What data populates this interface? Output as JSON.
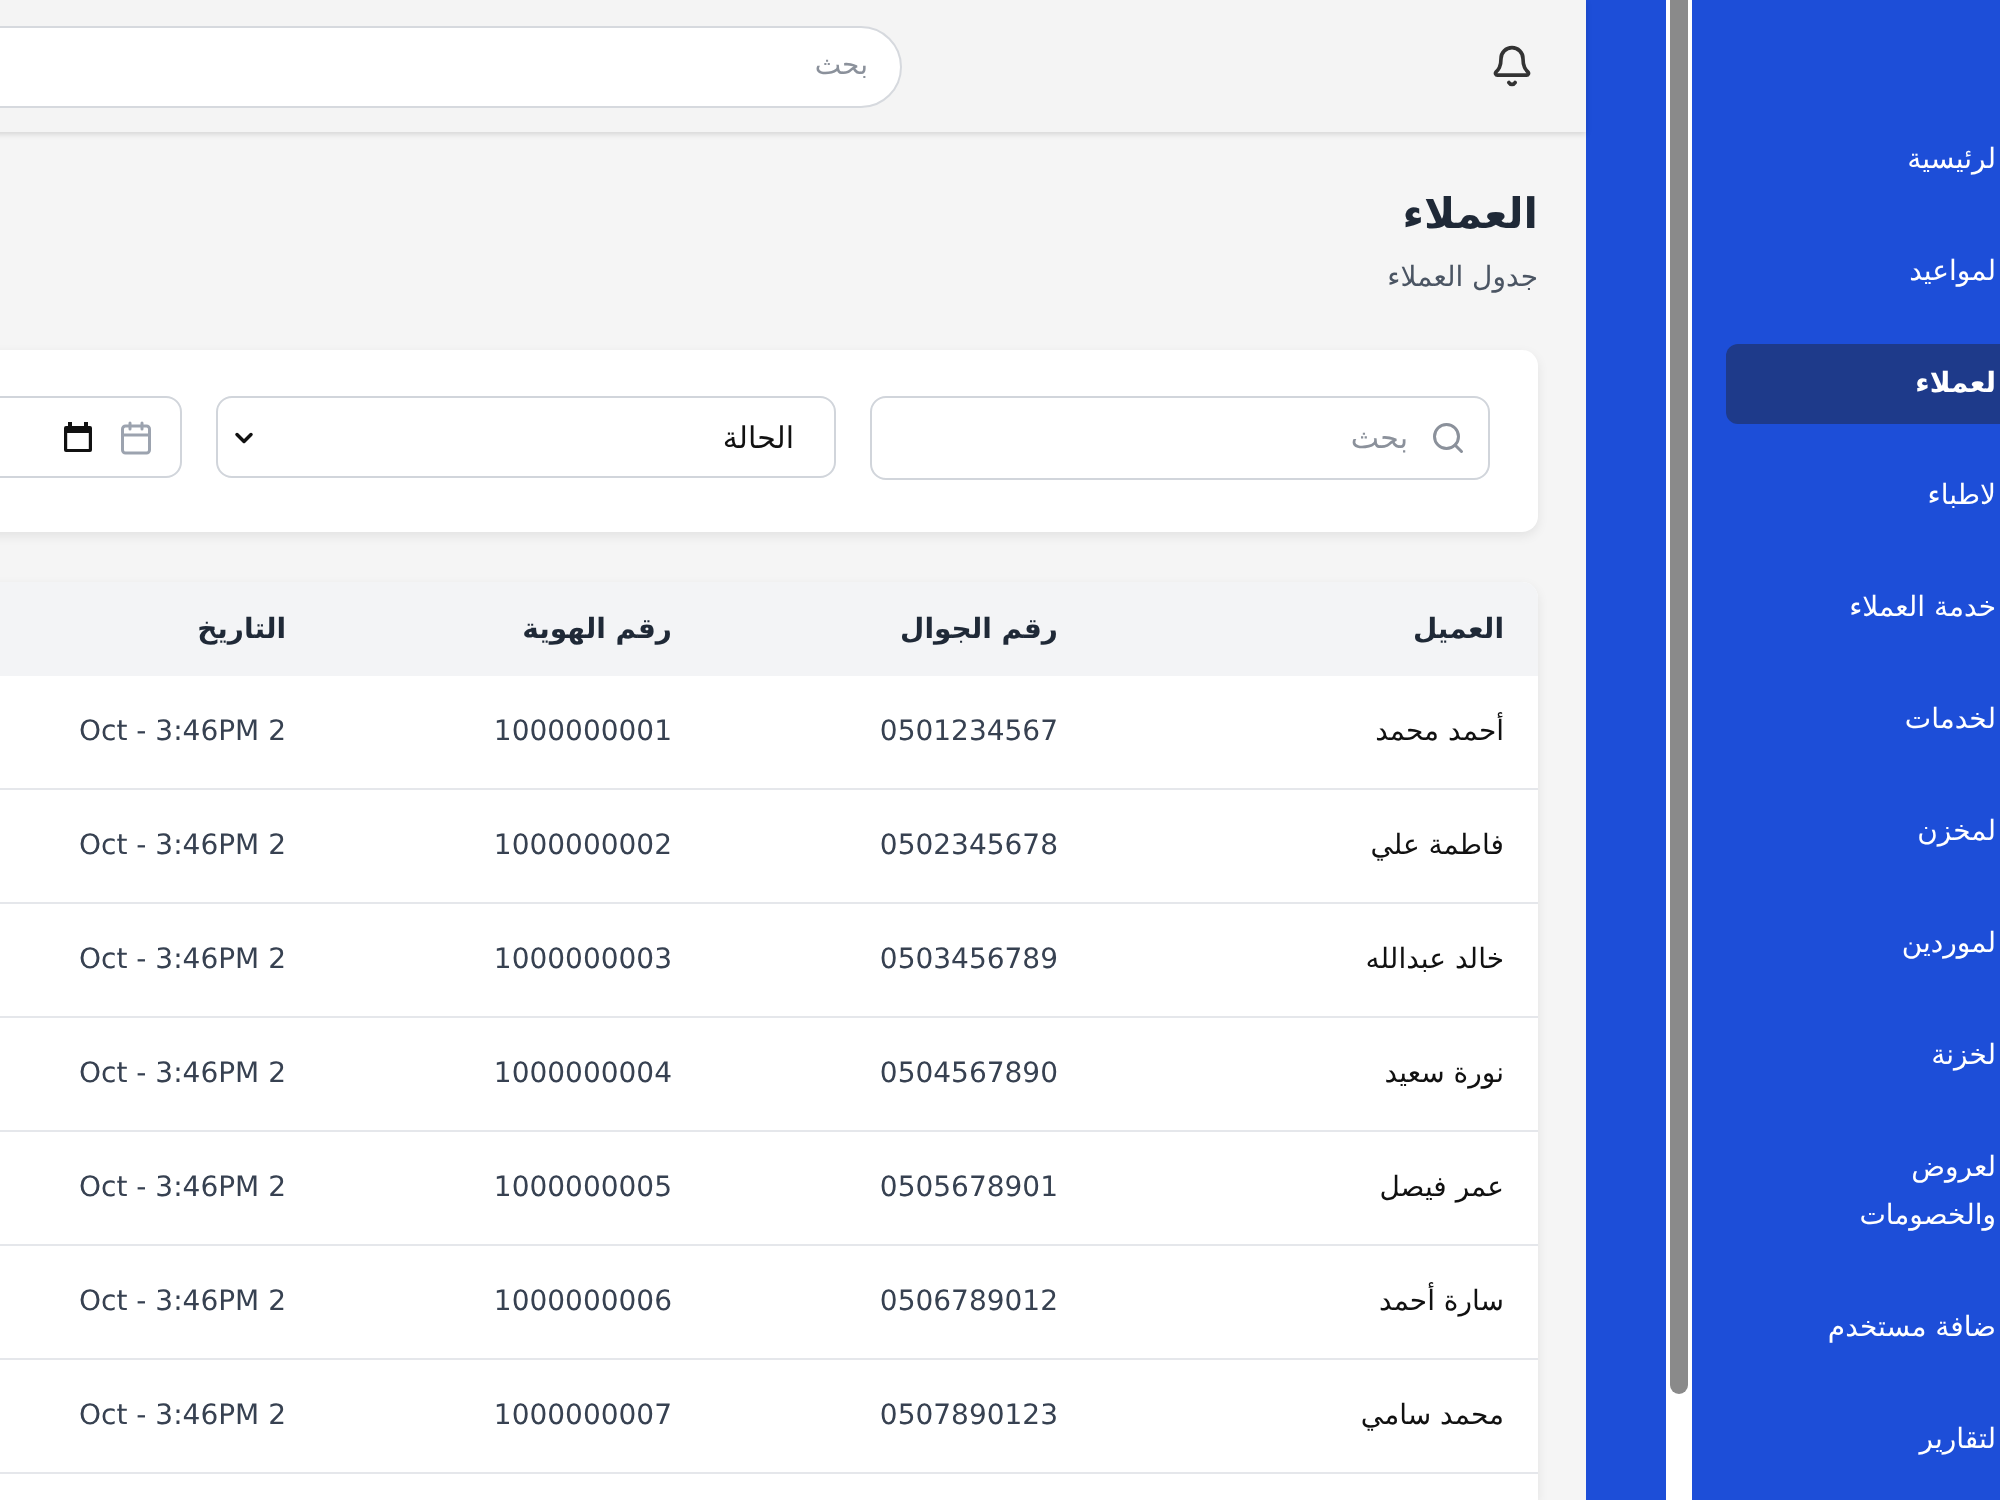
{
  "sidebar": {
    "items": [
      {
        "label": "لرئيسية",
        "selected": false
      },
      {
        "label": "لمواعيد",
        "selected": false
      },
      {
        "label": "لعملاء",
        "selected": true
      },
      {
        "label": "لاطباء",
        "selected": false
      },
      {
        "label": "خدمة العملاء",
        "selected": false
      },
      {
        "label": "لخدمات",
        "selected": false
      },
      {
        "label": "لمخزن",
        "selected": false
      },
      {
        "label": "لموردين",
        "selected": false
      },
      {
        "label": "لخزنة",
        "selected": false
      },
      {
        "label": "لعروض والخصومات",
        "selected": false
      },
      {
        "label": "ضافة مستخدم",
        "selected": false
      },
      {
        "label": "لتقارير",
        "selected": false
      }
    ]
  },
  "header": {
    "search": {
      "placeholder": "بحث"
    }
  },
  "page": {
    "title": "العملاء",
    "subtitle": "جدول العملاء"
  },
  "filters": {
    "search": {
      "placeholder": "بحث"
    },
    "status_select": {
      "value": "الحالة"
    }
  },
  "table": {
    "columns": [
      "العميل",
      "رقم الجوال",
      "رقم الهوية",
      "التاريخ"
    ],
    "rows": [
      [
        "أحمد محمد",
        "0501234567",
        "1000000001",
        "Oct - 3:46PM 2"
      ],
      [
        "فاطمة علي",
        "0502345678",
        "1000000002",
        "Oct - 3:46PM 2"
      ],
      [
        "خالد عبدالله",
        "0503456789",
        "1000000003",
        "Oct - 3:46PM 2"
      ],
      [
        "نورة سعيد",
        "0504567890",
        "1000000004",
        "Oct - 3:46PM 2"
      ],
      [
        "عمر فيصل",
        "0505678901",
        "1000000005",
        "Oct - 3:46PM 2"
      ],
      [
        "سارة أحمد",
        "0506789012",
        "1000000006",
        "Oct - 3:46PM 2"
      ],
      [
        "محمد سامي",
        "0507890123",
        "1000000007",
        "Oct - 3:46PM 2"
      ]
    ]
  }
}
